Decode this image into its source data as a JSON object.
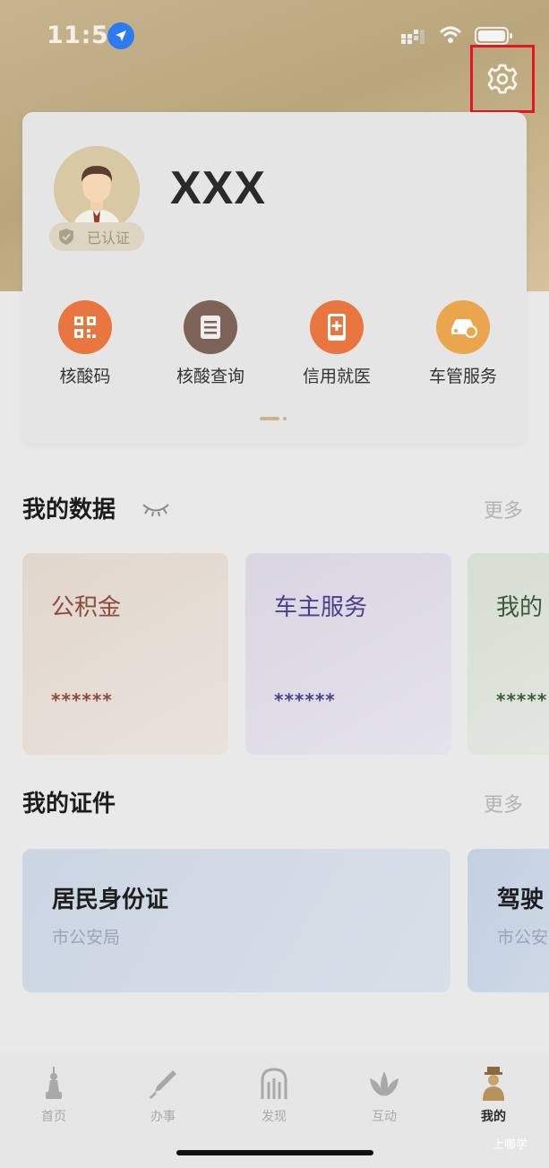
{
  "status_bar": {
    "time": "11:52"
  },
  "profile": {
    "name": "XXX",
    "verified_label": "已认证"
  },
  "quick_actions": [
    {
      "label": "核酸码",
      "icon": "qr-code-icon",
      "color": "#e8763e"
    },
    {
      "label": "核酸查询",
      "icon": "document-list-icon",
      "color": "#7d6257"
    },
    {
      "label": "信用就医",
      "icon": "medical-phone-icon",
      "color": "#e8763e"
    },
    {
      "label": "车管服务",
      "icon": "car-service-icon",
      "color": "#eba54c"
    }
  ],
  "my_data": {
    "title": "我的数据",
    "more": "更多",
    "cards": [
      {
        "title": "公积金",
        "value": "******",
        "color": "#8c4a3c"
      },
      {
        "title": "车主服务",
        "value": "******",
        "color": "#4a3f8a"
      },
      {
        "title": "我的",
        "value": "*****",
        "color": "#3a5a3a"
      }
    ]
  },
  "my_certs": {
    "title": "我的证件",
    "more": "更多",
    "cards": [
      {
        "title": "居民身份证",
        "subtitle": "市公安局"
      },
      {
        "title": "驾驶",
        "subtitle": "市公安"
      }
    ]
  },
  "tab_bar": {
    "items": [
      {
        "label": "首页",
        "icon": "home-tower-icon"
      },
      {
        "label": "办事",
        "icon": "pen-icon"
      },
      {
        "label": "发现",
        "icon": "arch-icon"
      },
      {
        "label": "互动",
        "icon": "lotus-icon"
      },
      {
        "label": "我的",
        "icon": "person-icon",
        "active": true
      }
    ]
  },
  "watermark": "上哪学",
  "colors": {
    "accent_gold": "#c9b587",
    "highlight_red": "#e8141f"
  }
}
